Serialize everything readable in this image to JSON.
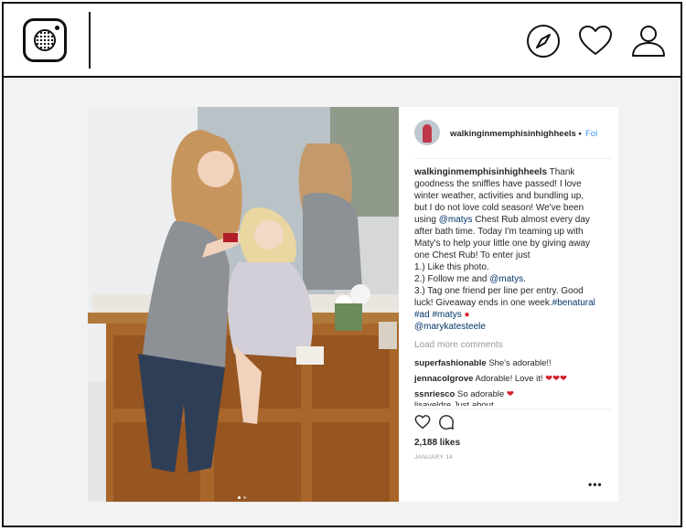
{
  "post": {
    "username": "walkinginmemphisinhighheels",
    "separator": "•",
    "follow_label": "Fol",
    "caption_parts": {
      "p1": " Thank goodness the sniffles have passed! I love winter weather, activities and bundling up, but I do not love cold season! We've been using ",
      "mention1": "@matys",
      "p2": " Chest Rub almost every day after bath time. Today I'm teaming up with Maty's to help your little one by giving away one Chest Rub! To enter just",
      "step1": "1.) Like this photo.",
      "step2_pre": "2.) Follow me and ",
      "mention2": "@matys",
      "step2_post": ".",
      "step3": "3.) Tag one friend per line per entry. Good luck! Giveaway ends in one week.",
      "tag1": "#benatural",
      "tag2": "#ad",
      "tag3": "#matys",
      "mention3": "@marykatesteele"
    },
    "load_more": "Load more comments",
    "comments": [
      {
        "user": "superfashionable",
        "text": "She's adorable!!",
        "emoji": ""
      },
      {
        "user": "jennacolgrove",
        "text": "Adorable! Love it!",
        "emoji": "❤❤❤"
      },
      {
        "user": "ssnriesco",
        "text": "So adorable",
        "emoji": "❤"
      }
    ],
    "partial_comment": "lisaveldre Just about",
    "likes": "2,188 likes",
    "date": "JANUARY 14",
    "more_label": "•••"
  },
  "icons": {
    "logo": "instagram-logo",
    "explore": "compass-icon",
    "activity": "heart-icon",
    "profile": "user-icon",
    "like": "heart-outline-icon",
    "comment": "comment-bubble-icon"
  },
  "colors": {
    "link": "#003569",
    "follow": "#3897f0",
    "muted": "#999999"
  }
}
